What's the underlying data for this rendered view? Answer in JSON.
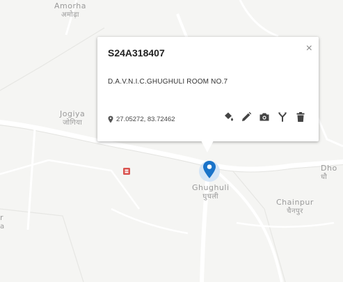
{
  "places": [
    {
      "id": "amorha",
      "en": "Amorha",
      "hi": "अमोढ़ा"
    },
    {
      "id": "jogiya",
      "en": "Jogiya",
      "hi": "जोगिया"
    },
    {
      "id": "ghughuli",
      "en": "Ghughuli",
      "hi": "घुघली"
    },
    {
      "id": "chainpur",
      "en": "Chainpur",
      "hi": "चैनपुर"
    },
    {
      "id": "dho",
      "en": "Dho",
      "hi": "धौ"
    },
    {
      "id": "edge",
      "en": "r",
      "hi": "a"
    }
  ],
  "popup": {
    "title": "S24A318407",
    "address": "D.A.V.N.I.C.GHUGHULI ROOM NO.7",
    "coords": "27.05272, 83.72462",
    "close": "×",
    "actions": [
      "paint-bucket-icon",
      "pencil-icon",
      "camera-icon",
      "fork-icon",
      "trash-icon"
    ]
  },
  "colors": {
    "marker": "#1a73c9",
    "marker_halo": "#cfe2f6",
    "poi": "#d9534f",
    "map_bg": "#f5f5f3",
    "road": "#ffffff"
  }
}
